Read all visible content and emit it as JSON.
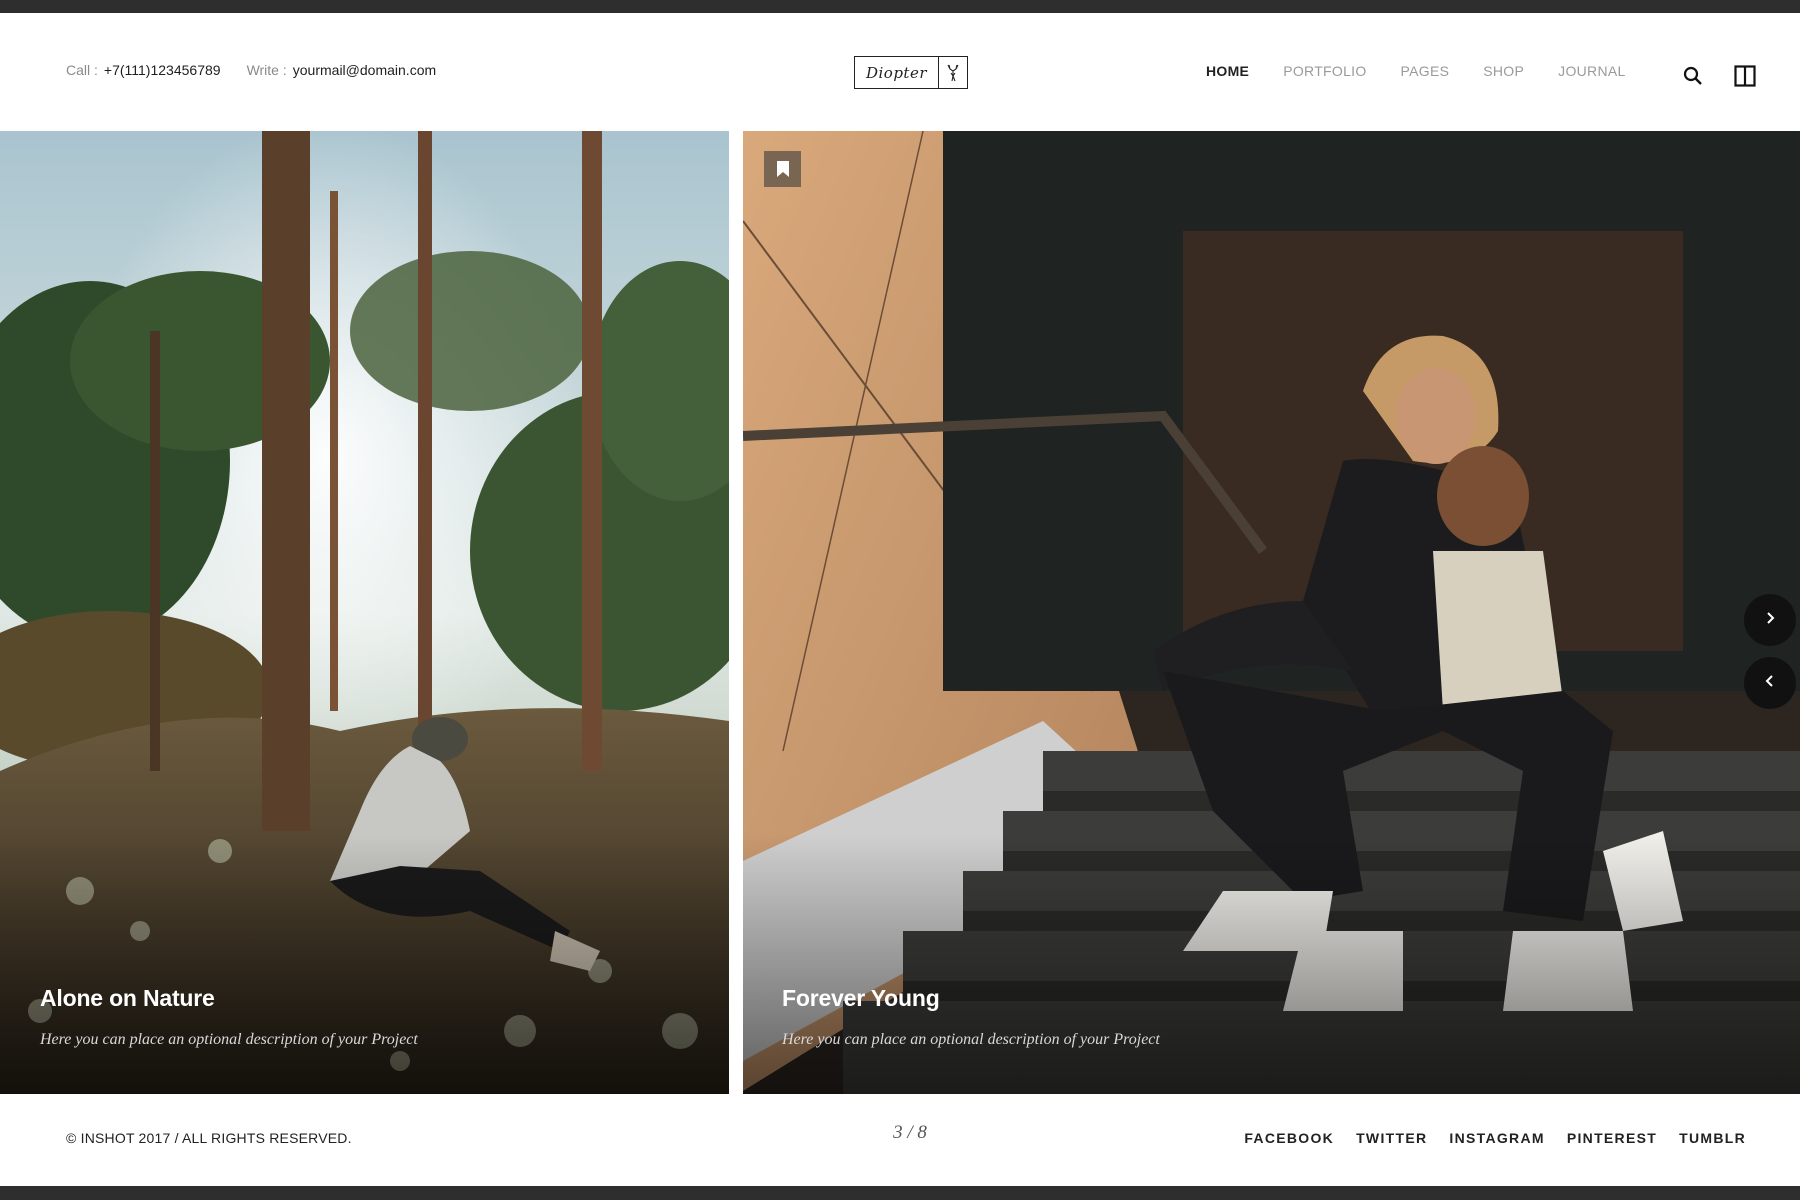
{
  "header": {
    "call_label": "Call :",
    "call_value": "+7(111)123456789",
    "write_label": "Write :",
    "write_value": "yourmail@domain.com",
    "logo_text": "Diopter",
    "logo_icon": "deer-icon",
    "nav": [
      {
        "label": "HOME",
        "active": true
      },
      {
        "label": "PORTFOLIO",
        "active": false
      },
      {
        "label": "PAGES",
        "active": false
      },
      {
        "label": "SHOP",
        "active": false
      },
      {
        "label": "JOURNAL",
        "active": false
      }
    ],
    "icons": [
      "search-icon",
      "sidebar-panel-icon"
    ]
  },
  "slides": [
    {
      "title": "Alone on Nature",
      "description": "Here you can place an optional description of your Project"
    },
    {
      "title": "Forever Young",
      "description": "Here you can place an optional description of your Project",
      "icon": "bookmark-icon"
    }
  ],
  "slider": {
    "next_icon": "chevron-right-icon",
    "prev_icon": "chevron-left-icon"
  },
  "footer": {
    "copyright": "© INSHOT 2017 / ALL RIGHTS RESERVED.",
    "counter": "3 / 8",
    "social": [
      "FACEBOOK",
      "TWITTER",
      "INSTAGRAM",
      "PINTEREST",
      "TUMBLR"
    ]
  },
  "colors": {
    "text_dark": "#222222",
    "text_muted": "#9a9a9a",
    "button_dark": "#111111"
  }
}
